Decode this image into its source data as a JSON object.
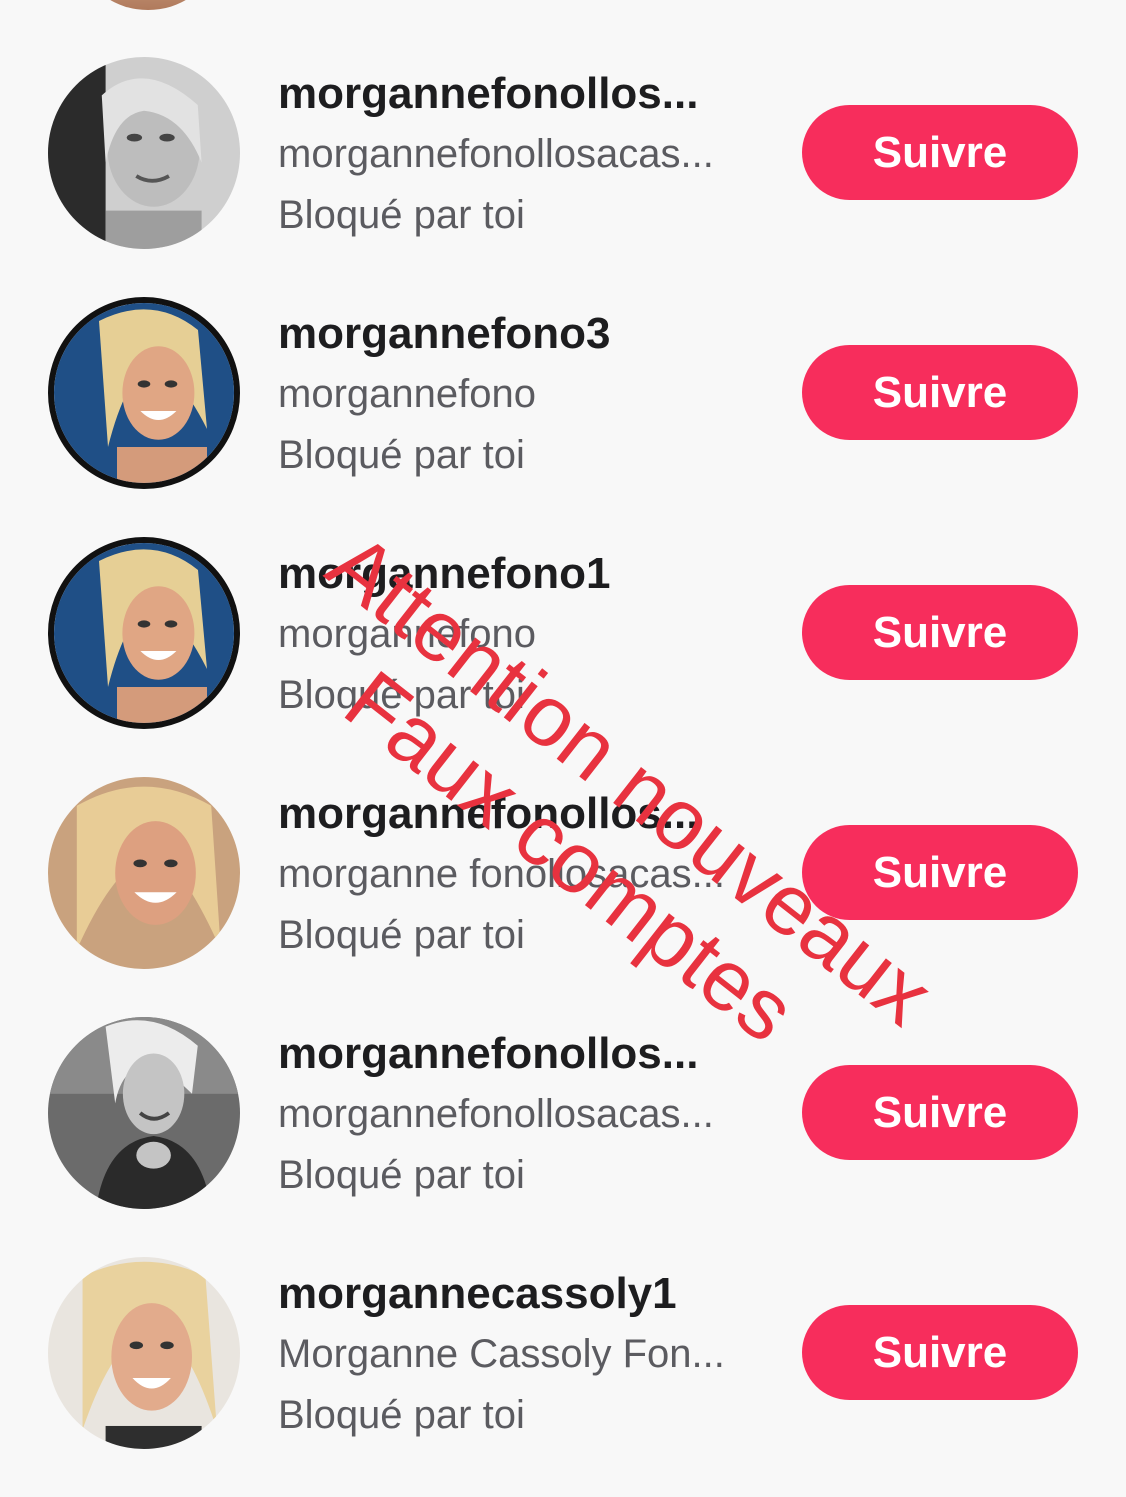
{
  "accounts": [
    {
      "username": "morgannefonollos...",
      "display_name": "morgannefonollosacas...",
      "status": "Bloqué par toi",
      "follow_label": "Suivre",
      "avatar": "grayscale-portrait"
    },
    {
      "username": "morgannefono3",
      "display_name": "morgannefono",
      "status": "Bloqué par toi",
      "follow_label": "Suivre",
      "avatar": "blonde-blue-background"
    },
    {
      "username": "morgannefono1",
      "display_name": "morgannefono",
      "status": "Bloqué par toi",
      "follow_label": "Suivre",
      "avatar": "blonde-blue-background"
    },
    {
      "username": "morgannefonollos...",
      "display_name": "morganne fonollosacas...",
      "status": "Bloqué par toi",
      "follow_label": "Suivre",
      "avatar": "blonde-warm-portrait"
    },
    {
      "username": "morgannefonollos...",
      "display_name": "morgannefonollosacas...",
      "status": "Bloqué par toi",
      "follow_label": "Suivre",
      "avatar": "grayscale-portrait"
    },
    {
      "username": "morgannecassoly1",
      "display_name": "Morganne Cassoly Fon...",
      "status": "Bloqué par toi",
      "follow_label": "Suivre",
      "avatar": "blonde-light-portrait"
    }
  ],
  "watermark": {
    "line1": "Attention nouveaux",
    "line2": "Faux comptes"
  },
  "colors": {
    "follow_button": "#f72d5c",
    "watermark": "#e8323f",
    "background": "#f8f8f8"
  }
}
